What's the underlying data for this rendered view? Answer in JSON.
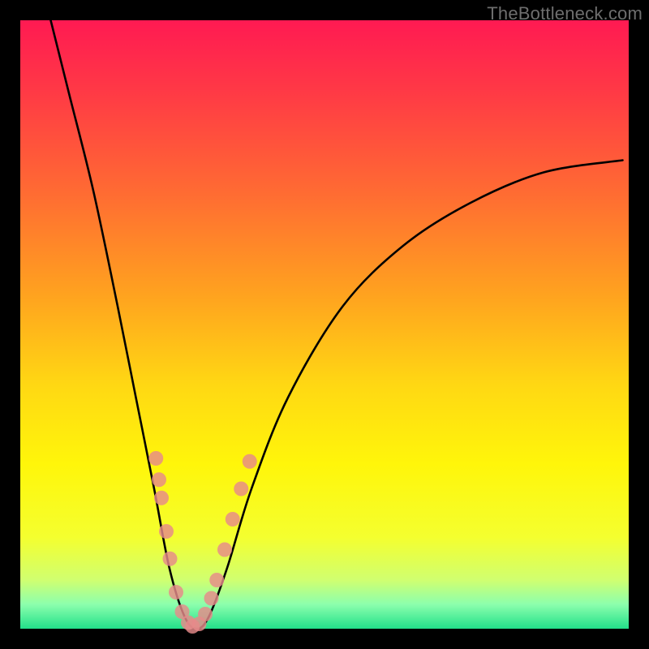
{
  "watermark": "TheBottleneck.com",
  "colors": {
    "background": "#000000",
    "curve_stroke": "#000000",
    "dot_fill": "#e78a8a"
  },
  "chart_data": {
    "type": "line",
    "title": "",
    "xlabel": "",
    "ylabel": "",
    "xlim": [
      0,
      100
    ],
    "ylim": [
      0,
      100
    ],
    "series": [
      {
        "name": "bottleneck-curve",
        "x": [
          5,
          8,
          12,
          16,
          19,
          22,
          24.5,
          27,
          29,
          31,
          34,
          38,
          44,
          53,
          63,
          74,
          86,
          99
        ],
        "y": [
          100,
          88,
          72,
          53,
          38,
          23,
          10,
          2,
          0,
          2,
          10,
          23,
          38,
          53,
          63,
          70,
          75,
          77
        ]
      }
    ],
    "markers": {
      "name": "highlighted-points",
      "x": [
        22.3,
        22.8,
        23.2,
        24.0,
        24.6,
        25.6,
        26.6,
        27.6,
        28.3,
        29.4,
        30.4,
        31.4,
        32.3,
        33.6,
        34.9,
        36.3,
        37.7
      ],
      "y": [
        28.0,
        24.5,
        21.5,
        16.0,
        11.5,
        6.0,
        2.8,
        1.0,
        0.4,
        0.8,
        2.4,
        5.0,
        8.0,
        13.0,
        18.0,
        23.0,
        27.5
      ]
    }
  }
}
